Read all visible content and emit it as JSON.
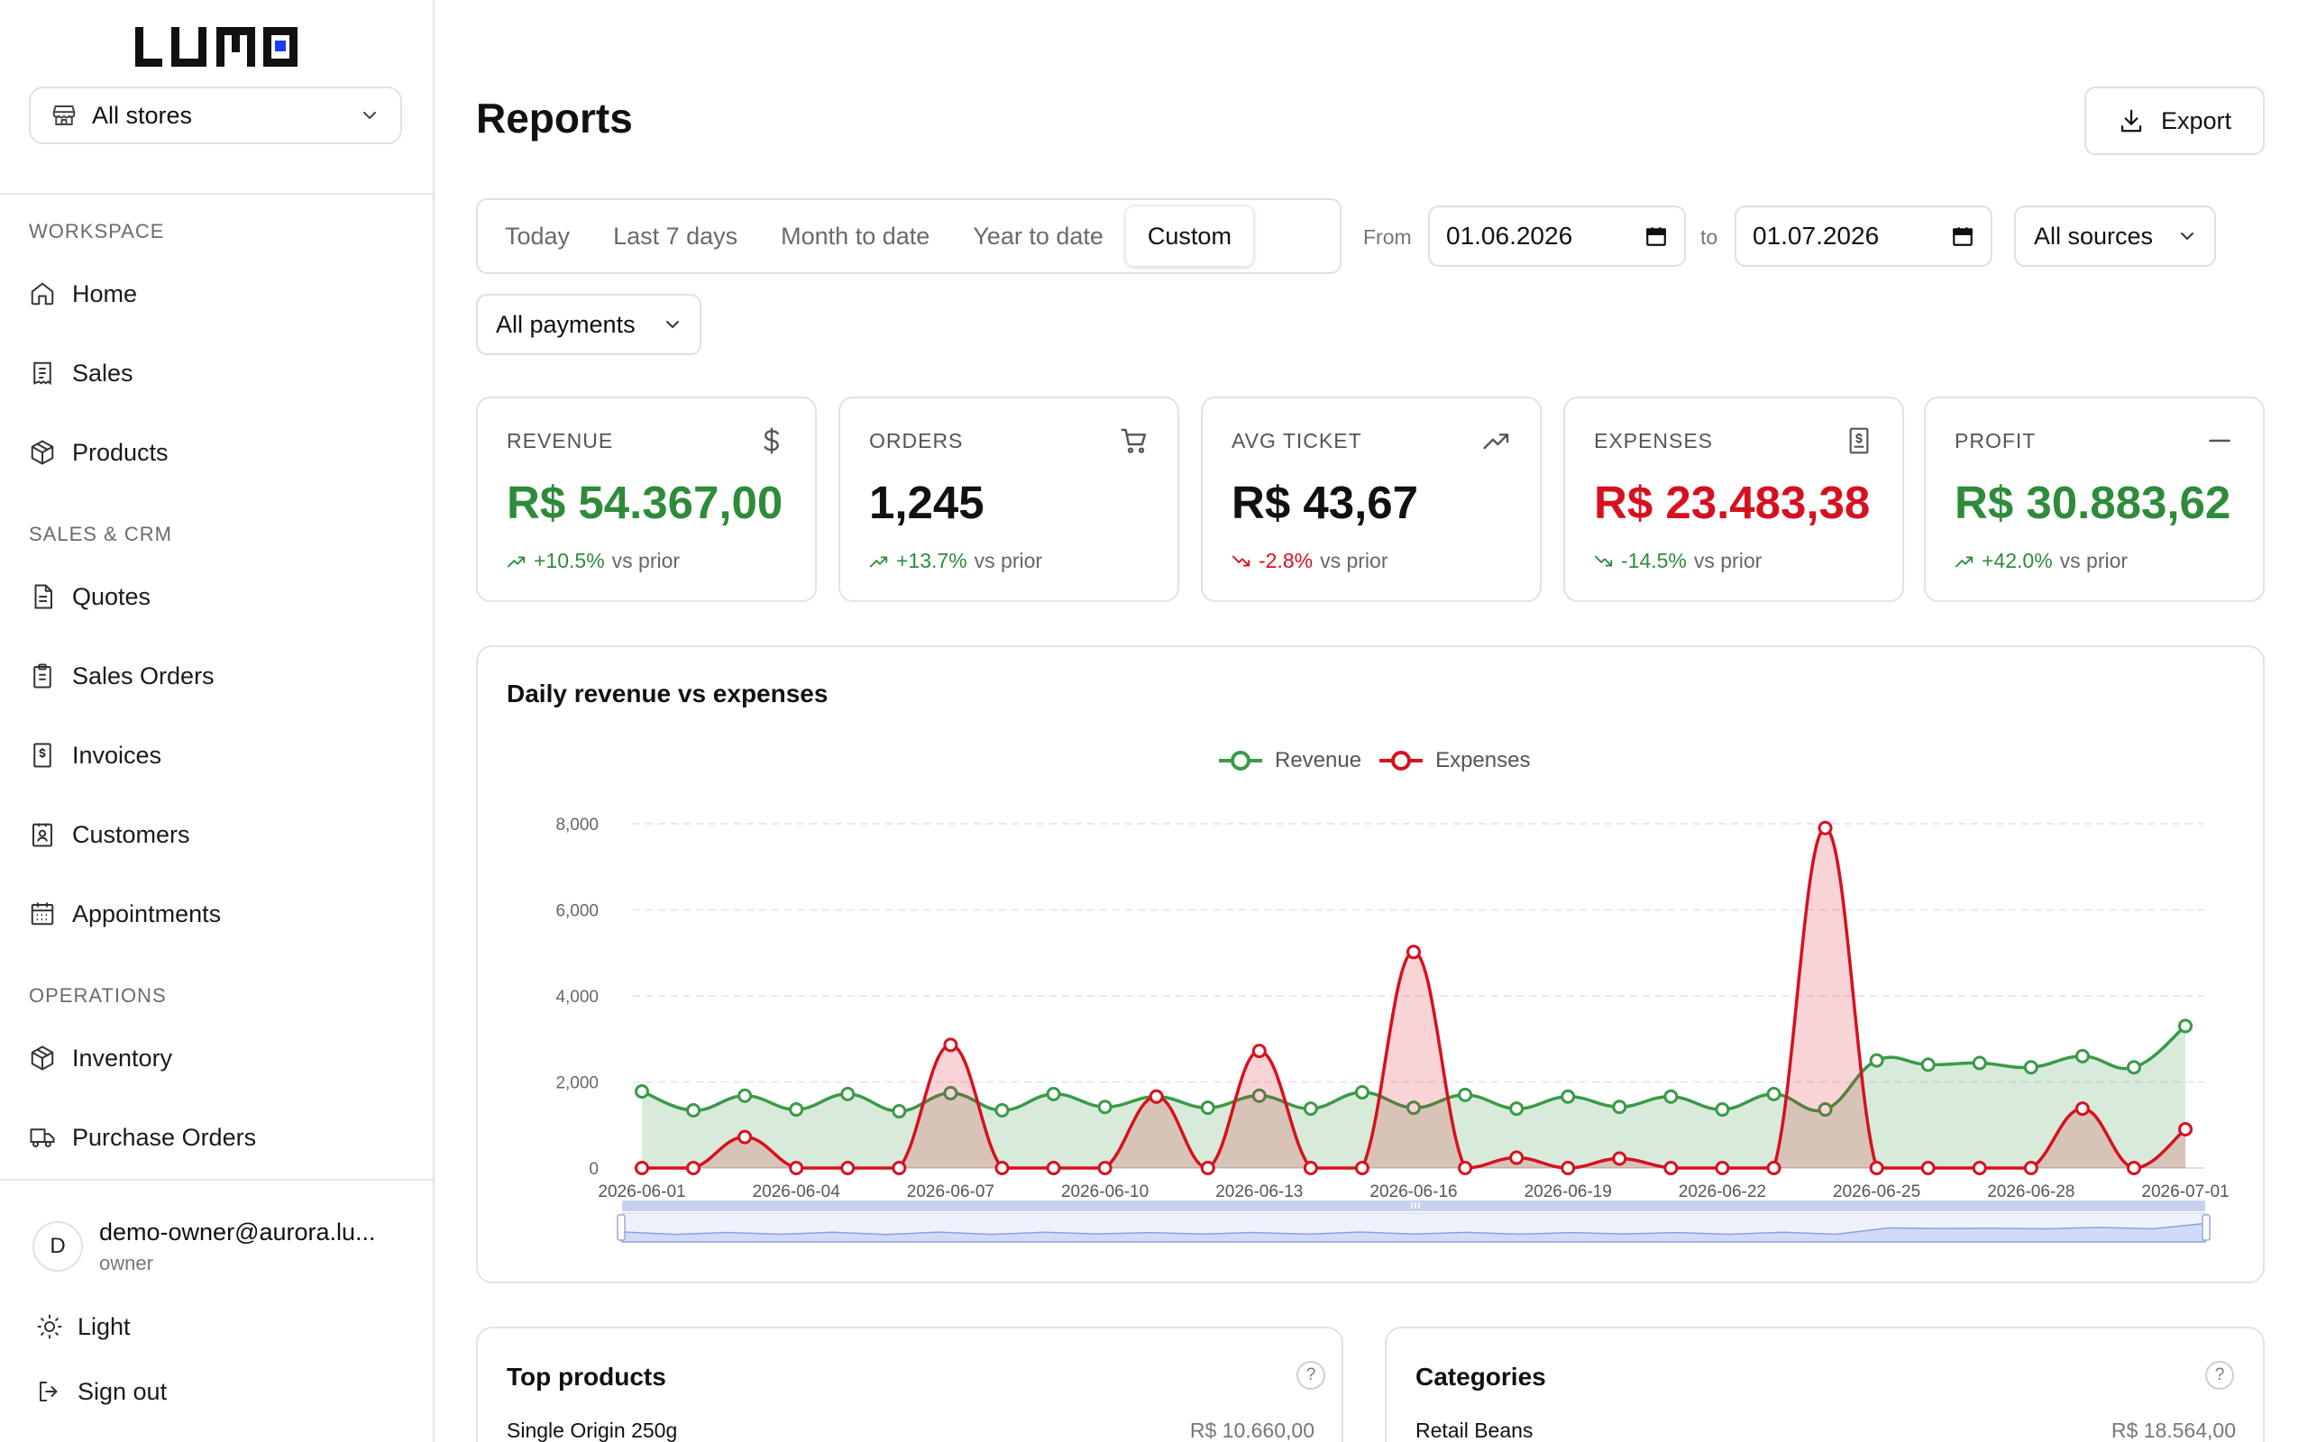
{
  "brand": {
    "logo_text": "LUMO"
  },
  "store_select": {
    "label": "All stores"
  },
  "sidebar": {
    "sections": [
      {
        "title": "WORKSPACE"
      },
      {
        "title": "SALES & CRM"
      },
      {
        "title": "OPERATIONS"
      }
    ],
    "items": [
      {
        "label": "Home",
        "icon": "home-icon"
      },
      {
        "label": "Sales",
        "icon": "receipt-icon"
      },
      {
        "label": "Products",
        "icon": "box-icon"
      },
      {
        "label": "Quotes",
        "icon": "document-icon"
      },
      {
        "label": "Sales Orders",
        "icon": "clipboard-icon"
      },
      {
        "label": "Invoices",
        "icon": "invoice-icon"
      },
      {
        "label": "Customers",
        "icon": "contact-icon"
      },
      {
        "label": "Appointments",
        "icon": "calendar-icon"
      },
      {
        "label": "Inventory",
        "icon": "box-icon"
      },
      {
        "label": "Purchase Orders",
        "icon": "truck-icon"
      }
    ]
  },
  "user": {
    "initial": "D",
    "email": "demo-owner@aurora.lu...",
    "role": "owner"
  },
  "footer": {
    "theme_label": "Light",
    "signout_label": "Sign out"
  },
  "header": {
    "title": "Reports",
    "export_label": "Export"
  },
  "filters": {
    "ranges": [
      "Today",
      "Last 7 days",
      "Month to date",
      "Year to date",
      "Custom"
    ],
    "active_range": "Custom",
    "from_label": "From",
    "from_value": "01.06.2026",
    "to_label": "to",
    "to_value": "01.07.2026",
    "sources": "All sources",
    "payments": "All payments"
  },
  "kpis": [
    {
      "label": "REVENUE",
      "value": "R$ 54.367,00",
      "delta": "+10.5%",
      "vs": "vs prior",
      "icon": "dollar-icon",
      "color": "#2e8b3a",
      "trend": "up"
    },
    {
      "label": "ORDERS",
      "value": "1,245",
      "delta": "+13.7%",
      "vs": "vs prior",
      "icon": "cart-icon",
      "color": "#111111",
      "trend": "up"
    },
    {
      "label": "AVG TICKET",
      "value": "R$ 43,67",
      "delta": "-2.8%",
      "vs": "vs prior",
      "icon": "trending-up-icon",
      "color": "#111111",
      "trend": "down-bad"
    },
    {
      "label": "EXPENSES",
      "value": "R$ 23.483,38",
      "delta": "-14.5%",
      "vs": "vs prior",
      "icon": "receipt-dollar-icon",
      "color": "#d7101f",
      "trend": "down-good"
    },
    {
      "label": "PROFIT",
      "value": "R$ 30.883,62",
      "delta": "+42.0%",
      "vs": "vs prior",
      "icon": "minus-icon",
      "color": "#2e8b3a",
      "trend": "up"
    }
  ],
  "colors": {
    "revenue": "#3a9a47",
    "expenses": "#d7101f",
    "positive": "#2e8b3a",
    "negative": "#d7101f"
  },
  "chart_data": {
    "type": "area",
    "title": "Daily revenue vs expenses",
    "xlabel": "",
    "ylabel": "",
    "ylim": [
      0,
      8000
    ],
    "yticks": [
      "0",
      "2,000",
      "4,000",
      "6,000",
      "8,000"
    ],
    "x_tick_labels": [
      "2026-06-01",
      "2026-06-04",
      "2026-06-07",
      "2026-06-10",
      "2026-06-13",
      "2026-06-16",
      "2026-06-19",
      "2026-06-22",
      "2026-06-25",
      "2026-06-28",
      "2026-07-01"
    ],
    "x": [
      "2026-06-01",
      "2026-06-02",
      "2026-06-03",
      "2026-06-04",
      "2026-06-05",
      "2026-06-06",
      "2026-06-07",
      "2026-06-08",
      "2026-06-09",
      "2026-06-10",
      "2026-06-11",
      "2026-06-12",
      "2026-06-13",
      "2026-06-14",
      "2026-06-15",
      "2026-06-16",
      "2026-06-17",
      "2026-06-18",
      "2026-06-19",
      "2026-06-20",
      "2026-06-21",
      "2026-06-22",
      "2026-06-23",
      "2026-06-24",
      "2026-06-25",
      "2026-06-26",
      "2026-06-27",
      "2026-06-28",
      "2026-06-29",
      "2026-06-30",
      "2026-07-01"
    ],
    "series": [
      {
        "name": "Revenue",
        "values": [
          1780,
          1340,
          1680,
          1360,
          1720,
          1320,
          1740,
          1340,
          1720,
          1420,
          1660,
          1400,
          1680,
          1380,
          1760,
          1400,
          1700,
          1380,
          1660,
          1420,
          1660,
          1360,
          1720,
          1360,
          2500,
          2400,
          2440,
          2340,
          2600,
          2340,
          3300
        ]
      },
      {
        "name": "Expenses",
        "values": [
          0,
          0,
          720,
          0,
          0,
          0,
          2860,
          0,
          0,
          0,
          1660,
          0,
          2720,
          0,
          0,
          5020,
          0,
          240,
          0,
          220,
          0,
          0,
          0,
          7900,
          0,
          0,
          0,
          0,
          1380,
          0,
          900
        ]
      }
    ],
    "legend_position": "top-center",
    "grid": true
  },
  "bottom": {
    "top_products": {
      "title": "Top products",
      "help": "?",
      "row_name": "Single Origin 250g",
      "row_value": "R$ 10.660,00"
    },
    "categories": {
      "title": "Categories",
      "help": "?",
      "row_name": "Retail Beans",
      "row_value": "R$ 18.564,00"
    }
  }
}
